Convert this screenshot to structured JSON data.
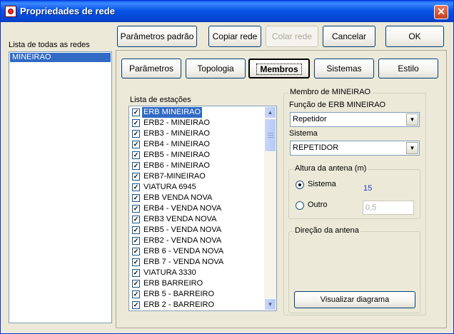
{
  "window": {
    "title": "Propriedades de rede",
    "close_label": "✕"
  },
  "left": {
    "label": "Lista de todas as redes",
    "items": [
      {
        "label": "MINEIRAO",
        "selected": true
      }
    ]
  },
  "toolbar": {
    "default_params": "Parâmetros padrão",
    "copy": "Copiar rede",
    "paste": "Colar rede",
    "cancel": "Cancelar",
    "ok": "OK"
  },
  "tabs": [
    {
      "label": "Parâmetros",
      "active": false
    },
    {
      "label": "Topologia",
      "active": false
    },
    {
      "label": "Membros",
      "active": true
    },
    {
      "label": "Sistemas",
      "active": false
    },
    {
      "label": "Estilo",
      "active": false
    }
  ],
  "stations": {
    "label": "Lista de estações",
    "items": [
      {
        "label": "ERB MINEIRAO",
        "checked": true,
        "selected": true
      },
      {
        "label": "ERB2 - MINEIRAO",
        "checked": true
      },
      {
        "label": "ERB3 - MINEIRAO",
        "checked": true
      },
      {
        "label": "ERB4 - MINEIRAO",
        "checked": true
      },
      {
        "label": "ERB5 - MINEIRAO",
        "checked": true
      },
      {
        "label": "ERB6 - MINEIRAO",
        "checked": true
      },
      {
        "label": "ERB7-MINEIRAO",
        "checked": true
      },
      {
        "label": "VIATURA 6945",
        "checked": true
      },
      {
        "label": "ERB VENDA NOVA",
        "checked": true
      },
      {
        "label": "ERB4 - VENDA NOVA",
        "checked": true
      },
      {
        "label": "ERB3 VENDA NOVA",
        "checked": true
      },
      {
        "label": "ERB5 - VENDA NOVA",
        "checked": true
      },
      {
        "label": "ERB2 - VENDA NOVA",
        "checked": true
      },
      {
        "label": "ERB 6 - VENDA NOVA",
        "checked": true
      },
      {
        "label": "ERB 7 - VENDA NOVA",
        "checked": true
      },
      {
        "label": "VIATURA 3330",
        "checked": true
      },
      {
        "label": "ERB BARREIRO",
        "checked": true
      },
      {
        "label": "ERB 5 - BARREIRO",
        "checked": true
      },
      {
        "label": "ERB 2 - BARREIRO",
        "checked": true
      }
    ]
  },
  "member": {
    "group_title": "Membro de MINEIRAO",
    "function_label": "Função de ERB MINEIRAO",
    "function_value": "Repetidor",
    "system_label": "Sistema",
    "system_value": "REPETIDOR",
    "antenna_height": {
      "title": "Altura da antena (m)",
      "option_system": "Sistema",
      "system_value": "15",
      "option_other": "Outro",
      "other_value": "0,5",
      "selected": "Sistema"
    },
    "antenna_direction": {
      "title": "Direção da antena",
      "button": "Visualizar diagrama"
    }
  },
  "colors": {
    "selection": "#316ac5",
    "titlebar": "#0755e6",
    "value_text": "#1a3ac7"
  }
}
